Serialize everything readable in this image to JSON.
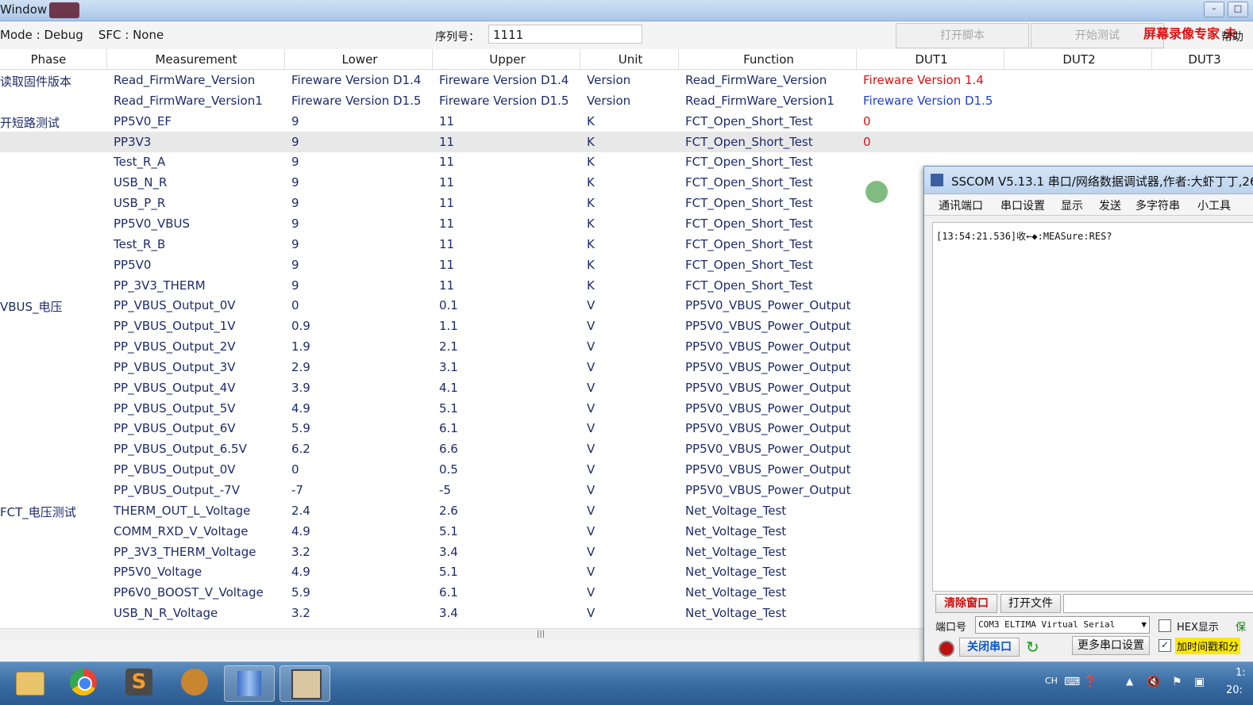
{
  "window": {
    "title": "Window"
  },
  "toolbar": {
    "mode_info": "Mode : Debug    SFC : None",
    "serial_label": "序列号：",
    "serial_value": "1111",
    "open_script_label": "打开脚本",
    "start_test_label": "开始测试",
    "watermark": "屏幕录像专家 未",
    "help_label": "帮助"
  },
  "table": {
    "columns": [
      "Phase",
      "Measurement",
      "Lower",
      "Upper",
      "Unit",
      "Function",
      "DUT1",
      "DUT2",
      "DUT3"
    ],
    "rows": [
      {
        "phase": "读取固件版本",
        "measurement": "Read_FirmWare_Version",
        "lower": "Fireware Version D1.4",
        "upper": "Fireware Version D1.4",
        "unit": "Version",
        "function": "Read_FirmWare_Version",
        "dut1": "Fireware Version 1.4",
        "dut1_color": "#e01010"
      },
      {
        "phase": "",
        "measurement": "Read_FirmWare_Version1",
        "lower": "Fireware Version D1.5",
        "upper": "Fireware Version D1.5",
        "unit": "Version",
        "function": "Read_FirmWare_Version1",
        "dut1": "Fireware Version D1.5",
        "dut1_color": "#1f3fd0"
      },
      {
        "phase": "开短路测试",
        "measurement": "PP5V0_EF",
        "lower": "9",
        "upper": "11",
        "unit": "K",
        "function": "FCT_Open_Short_Test",
        "dut1": "0",
        "dut1_color": "#e01010"
      },
      {
        "phase": "",
        "measurement": "PP3V3",
        "lower": "9",
        "upper": "11",
        "unit": "K",
        "function": "FCT_Open_Short_Test",
        "dut1": "0",
        "dut1_color": "#e01010",
        "selected": true
      },
      {
        "phase": "",
        "measurement": "Test_R_A",
        "lower": "9",
        "upper": "11",
        "unit": "K",
        "function": "FCT_Open_Short_Test",
        "dut1": ""
      },
      {
        "phase": "",
        "measurement": "USB_N_R",
        "lower": "9",
        "upper": "11",
        "unit": "K",
        "function": "FCT_Open_Short_Test",
        "dut1": ""
      },
      {
        "phase": "",
        "measurement": "USB_P_R",
        "lower": "9",
        "upper": "11",
        "unit": "K",
        "function": "FCT_Open_Short_Test",
        "dut1": ""
      },
      {
        "phase": "",
        "measurement": "PP5V0_VBUS",
        "lower": "9",
        "upper": "11",
        "unit": "K",
        "function": "FCT_Open_Short_Test",
        "dut1": ""
      },
      {
        "phase": "",
        "measurement": "Test_R_B",
        "lower": "9",
        "upper": "11",
        "unit": "K",
        "function": "FCT_Open_Short_Test",
        "dut1": ""
      },
      {
        "phase": "",
        "measurement": "PP5V0",
        "lower": "9",
        "upper": "11",
        "unit": "K",
        "function": "FCT_Open_Short_Test",
        "dut1": ""
      },
      {
        "phase": "",
        "measurement": "PP_3V3_THERM",
        "lower": "9",
        "upper": "11",
        "unit": "K",
        "function": "FCT_Open_Short_Test",
        "dut1": ""
      },
      {
        "phase": "VBUS_电压",
        "measurement": "PP_VBUS_Output_0V",
        "lower": "0",
        "upper": "0.1",
        "unit": "V",
        "function": "PP5V0_VBUS_Power_Output",
        "dut1": ""
      },
      {
        "phase": "",
        "measurement": "PP_VBUS_Output_1V",
        "lower": "0.9",
        "upper": "1.1",
        "unit": "V",
        "function": "PP5V0_VBUS_Power_Output",
        "dut1": ""
      },
      {
        "phase": "",
        "measurement": "PP_VBUS_Output_2V",
        "lower": "1.9",
        "upper": "2.1",
        "unit": "V",
        "function": "PP5V0_VBUS_Power_Output",
        "dut1": ""
      },
      {
        "phase": "",
        "measurement": "PP_VBUS_Output_3V",
        "lower": "2.9",
        "upper": "3.1",
        "unit": "V",
        "function": "PP5V0_VBUS_Power_Output",
        "dut1": ""
      },
      {
        "phase": "",
        "measurement": "PP_VBUS_Output_4V",
        "lower": "3.9",
        "upper": "4.1",
        "unit": "V",
        "function": "PP5V0_VBUS_Power_Output",
        "dut1": ""
      },
      {
        "phase": "",
        "measurement": "PP_VBUS_Output_5V",
        "lower": "4.9",
        "upper": "5.1",
        "unit": "V",
        "function": "PP5V0_VBUS_Power_Output",
        "dut1": ""
      },
      {
        "phase": "",
        "measurement": "PP_VBUS_Output_6V",
        "lower": "5.9",
        "upper": "6.1",
        "unit": "V",
        "function": "PP5V0_VBUS_Power_Output",
        "dut1": ""
      },
      {
        "phase": "",
        "measurement": "PP_VBUS_Output_6.5V",
        "lower": "6.2",
        "upper": "6.6",
        "unit": "V",
        "function": "PP5V0_VBUS_Power_Output",
        "dut1": ""
      },
      {
        "phase": "",
        "measurement": "PP_VBUS_Output_0V",
        "lower": "0",
        "upper": "0.5",
        "unit": "V",
        "function": "PP5V0_VBUS_Power_Output",
        "dut1": ""
      },
      {
        "phase": "",
        "measurement": "PP_VBUS_Output_-7V",
        "lower": "-7",
        "upper": "-5",
        "unit": "V",
        "function": "PP5V0_VBUS_Power_Output",
        "dut1": ""
      },
      {
        "phase": "FCT_电压测试",
        "measurement": "THERM_OUT_L_Voltage",
        "lower": "2.4",
        "upper": "2.6",
        "unit": "V",
        "function": "Net_Voltage_Test",
        "dut1": ""
      },
      {
        "phase": "",
        "measurement": "COMM_RXD_V_Voltage",
        "lower": "4.9",
        "upper": "5.1",
        "unit": "V",
        "function": "Net_Voltage_Test",
        "dut1": ""
      },
      {
        "phase": "",
        "measurement": "PP_3V3_THERM_Voltage",
        "lower": "3.2",
        "upper": "3.4",
        "unit": "V",
        "function": "Net_Voltage_Test",
        "dut1": ""
      },
      {
        "phase": "",
        "measurement": "PP5V0_Voltage",
        "lower": "4.9",
        "upper": "5.1",
        "unit": "V",
        "function": "Net_Voltage_Test",
        "dut1": ""
      },
      {
        "phase": "",
        "measurement": "PP6V0_BOOST_V_Voltage",
        "lower": "5.9",
        "upper": "6.1",
        "unit": "V",
        "function": "Net_Voltage_Test",
        "dut1": ""
      },
      {
        "phase": "",
        "measurement": "USB_N_R_Voltage",
        "lower": "3.2",
        "upper": "3.4",
        "unit": "V",
        "function": "Net_Voltage_Test",
        "dut1": ""
      }
    ]
  },
  "sscom": {
    "title": "SSCOM V5.13.1 串口/网络数据调试器,作者:大虾丁丁,26",
    "menu": [
      "通讯端口",
      "串口设置",
      "显示",
      "发送",
      "多字符串",
      "小工具"
    ],
    "receive_text": "[13:54:21.536]收←◆:MEASure:RES?",
    "clear_label": "清除窗口",
    "open_file_label": "打开文件",
    "port_label": "端口号",
    "port_value": "COM3 ELTIMA Virtual Serial",
    "hex_label": "HEX显示",
    "save_label": "保",
    "close_port_label": "关闭串口",
    "more_settings_label": "更多串口设置",
    "timestamp_label": "加时间戳和分"
  },
  "taskbar": {
    "lang": "CH",
    "clock_line1": "1:",
    "clock_line2": "20:"
  },
  "colors": {
    "accent": "#1d2b6b",
    "fail": "#e01010",
    "pass": "#1f3fd0"
  }
}
